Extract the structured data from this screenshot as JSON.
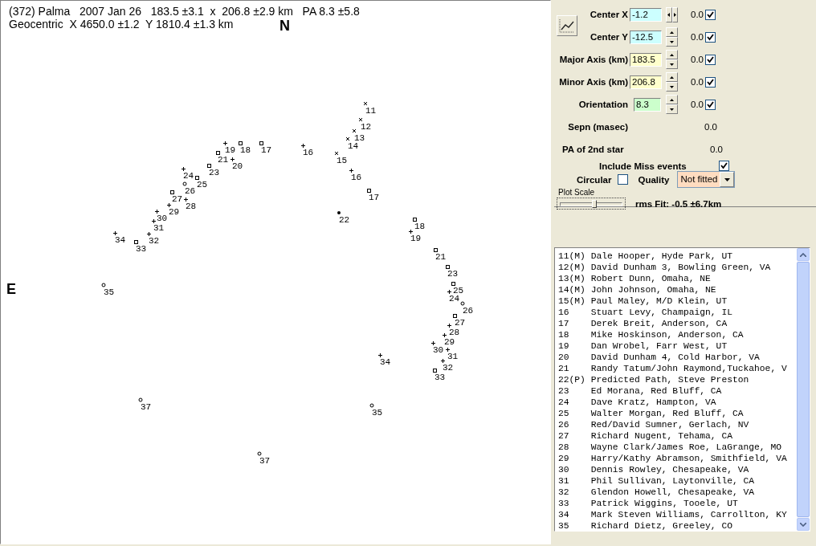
{
  "plot": {
    "header_lines": [
      "(372) Palma   2007 Jan 26   183.5 ±3.1  x  206.8 ±2.9 km   PA 8.3 ±5.8",
      "Geocentric  X 4650.0 ±1.2  Y 1810.4 ±1.3 km"
    ],
    "north_label": "N",
    "east_label": "E",
    "points": [
      {
        "label": "11",
        "kind": "cross"
      },
      {
        "label": "12",
        "kind": "cross"
      },
      {
        "label": "13",
        "kind": "cross"
      },
      {
        "label": "14",
        "kind": "cross"
      },
      {
        "label": "19",
        "kind": "plus"
      },
      {
        "label": "18",
        "kind": "square"
      },
      {
        "label": "17",
        "kind": "square"
      },
      {
        "label": "16",
        "kind": "plus"
      },
      {
        "label": "21",
        "kind": "square"
      },
      {
        "label": "15",
        "kind": "cross"
      },
      {
        "label": "20",
        "kind": "plus"
      },
      {
        "label": "23",
        "kind": "square"
      },
      {
        "label": "24",
        "kind": "plus"
      },
      {
        "label": "16",
        "kind": "plus"
      },
      {
        "label": "25",
        "kind": "square"
      },
      {
        "label": "26",
        "kind": "circle"
      },
      {
        "label": "27",
        "kind": "square"
      },
      {
        "label": "17",
        "kind": "square"
      },
      {
        "label": "28",
        "kind": "plus"
      },
      {
        "label": "29",
        "kind": "plus"
      },
      {
        "label": "30",
        "kind": "plus"
      },
      {
        "label": "22",
        "kind": "dot"
      },
      {
        "label": "31",
        "kind": "plus"
      },
      {
        "label": "18",
        "kind": "square"
      },
      {
        "label": "34",
        "kind": "plus"
      },
      {
        "label": "32",
        "kind": "plus"
      },
      {
        "label": "19",
        "kind": "plus"
      },
      {
        "label": "33",
        "kind": "square"
      },
      {
        "label": "21",
        "kind": "square"
      },
      {
        "label": "23",
        "kind": "square"
      },
      {
        "label": "35",
        "kind": "circle"
      },
      {
        "label": "25",
        "kind": "square"
      },
      {
        "label": "24",
        "kind": "plus"
      },
      {
        "label": "26",
        "kind": "circle"
      },
      {
        "label": "27",
        "kind": "square"
      },
      {
        "label": "28",
        "kind": "plus"
      },
      {
        "label": "29",
        "kind": "plus"
      },
      {
        "label": "30",
        "kind": "plus"
      },
      {
        "label": "31",
        "kind": "plus"
      },
      {
        "label": "34",
        "kind": "plus"
      },
      {
        "label": "32",
        "kind": "plus"
      },
      {
        "label": "33",
        "kind": "square"
      },
      {
        "label": "37",
        "kind": "circle"
      },
      {
        "label": "35",
        "kind": "circle"
      },
      {
        "label": "37",
        "kind": "circle"
      }
    ]
  },
  "parameters": [
    {
      "label": "Center X",
      "value": "-1.2",
      "color": "#ccffff",
      "kind": "horizontal",
      "result": "0.0",
      "checked": true
    },
    {
      "label": "Center Y",
      "value": "-12.5",
      "color": "#ccffff",
      "kind": "vertical",
      "result": "0.0",
      "checked": true
    },
    {
      "label": "Major Axis (km)",
      "value": "183.5",
      "color": "#ffffcc",
      "kind": "vertical",
      "result": "0.0",
      "checked": true
    },
    {
      "label": "Minor Axis (km)",
      "value": "206.8",
      "color": "#ffffcc",
      "kind": "vertical",
      "result": "0.0",
      "checked": true
    },
    {
      "label": "Orientation",
      "value": "8.3",
      "color": "#ccffcc",
      "kind": "vertical",
      "result": "0.0",
      "checked": true
    }
  ],
  "readouts": [
    {
      "label": "Sepn (masec)",
      "value": "0.0"
    },
    {
      "label": "PA of 2nd star",
      "value": "0.0"
    }
  ],
  "include_miss": {
    "label": "Include Miss events",
    "checked": true
  },
  "circular": {
    "label": "Circular",
    "checked": false
  },
  "quality": {
    "label": "Quality",
    "value": "Not fitted"
  },
  "plot_scale": {
    "label": "Plot Scale",
    "level": 0.55
  },
  "rms_fit": "rms Fit: -0.5 ±6.7km",
  "observers": [
    "11(M) Dale Hooper, Hyde Park, UT",
    "12(M) David Dunham 3, Bowling Green, VA",
    "13(M) Robert Dunn, Omaha, NE",
    "14(M) John Johnson, Omaha, NE",
    "15(M) Paul Maley, M/D Klein, UT",
    "16    Stuart Levy, Champaign, IL",
    "17    Derek Breit, Anderson, CA",
    "18    Mike Hoskinson, Anderson, CA",
    "19    Dan Wrobel, Farr West, UT",
    "20    David Dunham 4, Cold Harbor, VA",
    "21    Randy Tatum/John Raymond,Tuckahoe, V",
    "22(P) Predicted Path, Steve Preston",
    "23    Ed Morana, Red Bluff, CA",
    "24    Dave Kratz, Hampton, VA",
    "25    Walter Morgan, Red Bluff, CA",
    "26    Red/David Sumner, Gerlach, NV",
    "27    Richard Nugent, Tehama, CA",
    "28    Wayne Clark/James Roe, LaGrange, MO",
    "29    Harry/Kathy Abramson, Smithfield, VA",
    "30    Dennis Rowley, Chesapeake, VA",
    "31    Phil Sullivan, Laytonville, CA",
    "32    Glendon Howell, Chesapeake, VA",
    "33    Patrick Wiggins, Tooele, UT",
    "34    Mark Steven Williams, Carrollton, KY",
    "35    Richard Dietz, Greeley, CO"
  ]
}
